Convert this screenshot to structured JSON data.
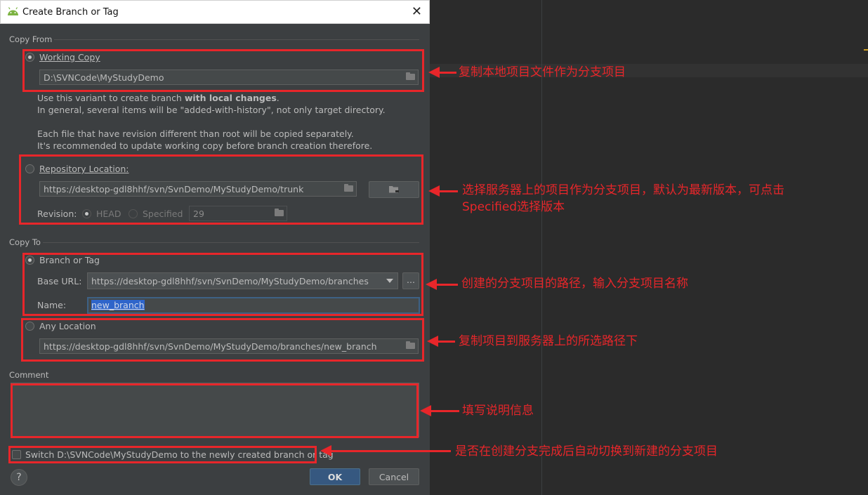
{
  "dialog": {
    "title": "Create Branch or Tag",
    "close_glyph": "✕",
    "copy_from": {
      "section_label": "Copy From",
      "working_copy_label": "Working Copy",
      "working_copy_path": "D:\\SVNCode\\MyStudyDemo",
      "description_lines": [
        "Use this variant to create branch ",
        "with local changes",
        ".",
        "In general, several items will be \"added-with-history\", not only target directory.",
        "Each file that have revision different than root will be copied separately.",
        "It's recommended to update working copy before branch creation therefore."
      ],
      "repository_location_label": "Repository Location:",
      "repository_url": "https://desktop-gdl8hhf/svn/SvnDemo/MyStudyDemo/trunk",
      "revision_label": "Revision:",
      "head_label": "HEAD",
      "specified_label": "Specified",
      "revision_value": "29"
    },
    "copy_to": {
      "section_label": "Copy To",
      "branch_or_tag_label": "Branch or Tag",
      "base_url_label": "Base URL:",
      "base_url_value": "https://desktop-gdl8hhf/svn/SvnDemo/MyStudyDemo/branches",
      "browse_label": "...",
      "name_label": "Name:",
      "name_value": "new_branch",
      "any_location_label": "Any Location",
      "any_location_url": "https://desktop-gdl8hhf/svn/SvnDemo/MyStudyDemo/branches/new_branch"
    },
    "comment_label": "Comment",
    "comment_value": "",
    "switch_label": "Switch D:\\SVNCode\\MyStudyDemo to the newly created branch or tag",
    "help_glyph": "?",
    "ok_label": "OK",
    "cancel_label": "Cancel"
  },
  "annotations": {
    "working_copy": "复制本地项目文件作为分支项目",
    "repository_line1": "选择服务器上的项目作为分支项目，默认为最新版本，可点击",
    "repository_line2": "Specified选择版本",
    "branch_or_tag": "创建的分支项目的路径，输入分支项目名称",
    "any_location": "复制项目到服务器上的所选路径下",
    "comment": "填写说明信息",
    "switch": "是否在创建分支完成后自动切换到新建的分支项目"
  },
  "colors": {
    "annotation_red": "#e8262a",
    "dialog_bg": "#3c3f41",
    "editor_bg": "#2b2b2b",
    "primary_button": "#365880",
    "selection": "#2f65ca"
  },
  "icons": [
    "android-icon",
    "close-icon",
    "folder-icon",
    "browse-server-icon",
    "dropdown-arrow-icon",
    "help-icon"
  ]
}
